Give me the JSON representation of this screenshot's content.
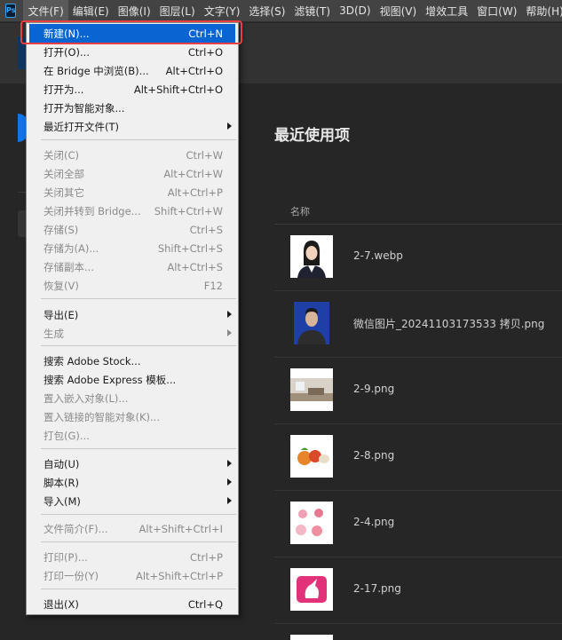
{
  "menubar": {
    "logo": "Ps",
    "items": [
      "文件(F)",
      "编辑(E)",
      "图像(I)",
      "图层(L)",
      "文字(Y)",
      "选择(S)",
      "滤镜(T)",
      "3D(D)",
      "视图(V)",
      "增效工具",
      "窗口(W)",
      "帮助(H)"
    ],
    "active_index": 0
  },
  "home": {
    "recent_title": "最近使用项",
    "column_name": "名称",
    "files": [
      {
        "name": "2-7.webp",
        "thumb": "portrait-woman-icon"
      },
      {
        "name": "微信图片_20241103173533 拷贝.png",
        "thumb": "portrait-man-icon"
      },
      {
        "name": "2-9.png",
        "thumb": "room-photo-icon"
      },
      {
        "name": "2-8.png",
        "thumb": "fruit-photo-icon"
      },
      {
        "name": "2-4.png",
        "thumb": "flowers-photo-icon"
      },
      {
        "name": "2-17.png",
        "thumb": "unicorn-logo-icon"
      }
    ]
  },
  "file_menu": {
    "items": [
      {
        "label": "新建(N)...",
        "shortcut": "Ctrl+N",
        "enabled": true,
        "highlight": true
      },
      {
        "label": "打开(O)...",
        "shortcut": "Ctrl+O",
        "enabled": true
      },
      {
        "label": "在 Bridge 中浏览(B)...",
        "shortcut": "Alt+Ctrl+O",
        "enabled": true
      },
      {
        "label": "打开为...",
        "shortcut": "Alt+Shift+Ctrl+O",
        "enabled": true
      },
      {
        "label": "打开为智能对象...",
        "shortcut": "",
        "enabled": true
      },
      {
        "label": "最近打开文件(T)",
        "shortcut": "",
        "enabled": true,
        "submenu": true
      },
      {
        "label": "关闭(C)",
        "shortcut": "Ctrl+W",
        "enabled": false
      },
      {
        "label": "关闭全部",
        "shortcut": "Alt+Ctrl+W",
        "enabled": false
      },
      {
        "label": "关闭其它",
        "shortcut": "Alt+Ctrl+P",
        "enabled": false
      },
      {
        "label": "关闭并转到 Bridge...",
        "shortcut": "Shift+Ctrl+W",
        "enabled": false
      },
      {
        "label": "存储(S)",
        "shortcut": "Ctrl+S",
        "enabled": false
      },
      {
        "label": "存储为(A)...",
        "shortcut": "Shift+Ctrl+S",
        "enabled": false
      },
      {
        "label": "存储副本...",
        "shortcut": "Alt+Ctrl+S",
        "enabled": false
      },
      {
        "label": "恢复(V)",
        "shortcut": "F12",
        "enabled": false
      },
      {
        "label": "导出(E)",
        "shortcut": "",
        "enabled": true,
        "submenu": true
      },
      {
        "label": "生成",
        "shortcut": "",
        "enabled": false,
        "submenu": true
      },
      {
        "label": "搜索 Adobe Stock...",
        "shortcut": "",
        "enabled": true
      },
      {
        "label": "搜索 Adobe Express 模板...",
        "shortcut": "",
        "enabled": true
      },
      {
        "label": "置入嵌入对象(L)...",
        "shortcut": "",
        "enabled": false
      },
      {
        "label": "置入链接的智能对象(K)...",
        "shortcut": "",
        "enabled": false
      },
      {
        "label": "打包(G)...",
        "shortcut": "",
        "enabled": false
      },
      {
        "label": "自动(U)",
        "shortcut": "",
        "enabled": true,
        "submenu": true
      },
      {
        "label": "脚本(R)",
        "shortcut": "",
        "enabled": true,
        "submenu": true
      },
      {
        "label": "导入(M)",
        "shortcut": "",
        "enabled": true,
        "submenu": true
      },
      {
        "label": "文件简介(F)...",
        "shortcut": "Alt+Shift+Ctrl+I",
        "enabled": false
      },
      {
        "label": "打印(P)...",
        "shortcut": "Ctrl+P",
        "enabled": false
      },
      {
        "label": "打印一份(Y)",
        "shortcut": "Alt+Shift+Ctrl+P",
        "enabled": false
      },
      {
        "label": "退出(X)",
        "shortcut": "Ctrl+Q",
        "enabled": true
      }
    ]
  },
  "colors": {
    "highlight": "#0a64d2",
    "annotation_ring": "#e9403f",
    "menu_bg": "#f0f0f0",
    "app_bg": "#262626"
  }
}
